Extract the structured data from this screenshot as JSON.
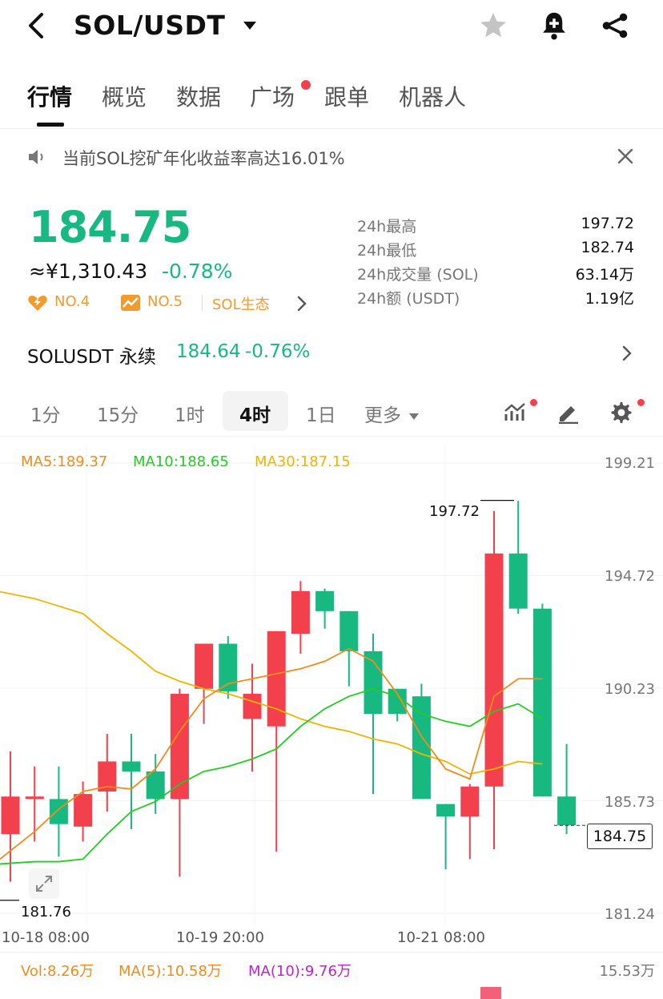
{
  "header": {
    "pair": "SOL/USDT"
  },
  "tabs": [
    {
      "label": "行情",
      "active": true
    },
    {
      "label": "概览"
    },
    {
      "label": "数据"
    },
    {
      "label": "广场",
      "dot": true
    },
    {
      "label": "跟单"
    },
    {
      "label": "机器人"
    }
  ],
  "notice": {
    "text": "当前SOL挖矿年化收益率高达16.01%"
  },
  "price": {
    "last": "184.75",
    "cny": "≈¥1,310.43",
    "change_pct": "-0.78%",
    "color_down": "#17b981",
    "color_up": "#f2404c"
  },
  "ranks": [
    {
      "label": "NO.4",
      "icon": "hot-icon"
    },
    {
      "label": "NO.5",
      "icon": "trend-icon"
    },
    {
      "label": "SOL生态",
      "icon": ""
    }
  ],
  "stats": [
    {
      "label": "24h最高",
      "value": "197.72"
    },
    {
      "label": "24h最低",
      "value": "182.74"
    },
    {
      "label": "24h成交量 (SOL)",
      "value": "63.14万"
    },
    {
      "label": "24h额 (USDT)",
      "value": "1.19亿"
    }
  ],
  "perpetual": {
    "name": "SOLUSDT 永续",
    "price": "184.64",
    "change_pct": "-0.76%"
  },
  "intervals": [
    {
      "label": "1分"
    },
    {
      "label": "15分"
    },
    {
      "label": "1时"
    },
    {
      "label": "4时",
      "active": true
    },
    {
      "label": "1日"
    },
    {
      "label": "更多"
    }
  ],
  "chart": {
    "ma_legend": [
      {
        "label": "MA5:189.37",
        "color": "#f08c1a"
      },
      {
        "label": "MA10:188.65",
        "color": "#22cc22"
      },
      {
        "label": "MA30:187.15",
        "color": "#f0b400"
      }
    ],
    "price_axis": [
      "199.21",
      "194.72",
      "190.23",
      "185.73",
      "181.24"
    ],
    "time_axis": [
      "10-18 08:00",
      "10-19 20:00",
      "10-21 08:00"
    ],
    "high_label": "197.72",
    "low_label": "181.76",
    "current_tag": "184.75"
  },
  "chart_data": {
    "type": "candlestick",
    "ylim": [
      181.24,
      199.21
    ],
    "candles": [
      {
        "o": 184.4,
        "h": 187.7,
        "l": 182.5,
        "c": 185.9
      },
      {
        "o": 185.8,
        "h": 187.1,
        "l": 184.1,
        "c": 185.9
      },
      {
        "o": 185.8,
        "h": 187.1,
        "l": 183.5,
        "c": 184.8
      },
      {
        "o": 184.7,
        "h": 186.5,
        "l": 184.1,
        "c": 186.0
      },
      {
        "o": 186.1,
        "h": 188.4,
        "l": 185.3,
        "c": 187.3
      },
      {
        "o": 187.3,
        "h": 188.4,
        "l": 184.6,
        "c": 186.9
      },
      {
        "o": 186.9,
        "h": 187.6,
        "l": 185.2,
        "c": 185.8
      },
      {
        "o": 185.8,
        "h": 190.2,
        "l": 182.7,
        "c": 190.0
      },
      {
        "o": 190.2,
        "h": 191.8,
        "l": 188.8,
        "c": 192.0
      },
      {
        "o": 192.0,
        "h": 192.3,
        "l": 189.8,
        "c": 190.1
      },
      {
        "o": 189.0,
        "h": 191.2,
        "l": 186.9,
        "c": 190.0
      },
      {
        "o": 188.7,
        "h": 192.5,
        "l": 183.7,
        "c": 192.5
      },
      {
        "o": 192.4,
        "h": 194.5,
        "l": 191.6,
        "c": 194.1
      },
      {
        "o": 194.1,
        "h": 194.2,
        "l": 192.6,
        "c": 193.3
      },
      {
        "o": 193.3,
        "h": 193.3,
        "l": 190.3,
        "c": 191.7
      },
      {
        "o": 191.7,
        "h": 192.4,
        "l": 186.0,
        "c": 189.2
      },
      {
        "o": 190.2,
        "h": 190.2,
        "l": 188.9,
        "c": 189.2
      },
      {
        "o": 189.9,
        "h": 190.4,
        "l": 185.8,
        "c": 185.8
      },
      {
        "o": 185.6,
        "h": 185.6,
        "l": 183.0,
        "c": 185.1
      },
      {
        "o": 185.1,
        "h": 186.4,
        "l": 183.4,
        "c": 186.3
      },
      {
        "o": 186.3,
        "h": 197.3,
        "l": 183.8,
        "c": 195.6
      },
      {
        "o": 195.6,
        "h": 197.7,
        "l": 193.2,
        "c": 193.4
      },
      {
        "o": 193.4,
        "h": 193.6,
        "l": 185.9,
        "c": 185.9
      },
      {
        "o": 185.9,
        "h": 188.0,
        "l": 184.4,
        "c": 184.75
      }
    ],
    "ma5": [
      183.3,
      184.5,
      185.4,
      186.1,
      186.3,
      186.2,
      187.0,
      188.5,
      189.8,
      190.4,
      190.6,
      190.8,
      191.0,
      191.3,
      191.8,
      191.3,
      190.0,
      188.3,
      187.0,
      186.6,
      189.9,
      190.6,
      190.6
    ],
    "ma10": [
      183.2,
      183.3,
      183.3,
      183.4,
      184.4,
      185.3,
      185.7,
      186.4,
      186.9,
      187.1,
      187.4,
      187.8,
      188.7,
      189.4,
      189.9,
      190.2,
      189.9,
      189.2,
      188.9,
      188.7,
      189.3,
      189.6,
      189.0
    ],
    "ma30": [
      194.1,
      193.8,
      193.5,
      193.2,
      192.4,
      191.7,
      190.9,
      190.5,
      190.2,
      190.0,
      189.7,
      189.4,
      189.0,
      188.7,
      188.5,
      188.2,
      188.0,
      187.6,
      187.3,
      186.8,
      187.0,
      187.3,
      187.2
    ]
  },
  "volume": {
    "vol": "Vol:8.26万",
    "ma5": "MA(5):10.58万",
    "ma10": "MA(10):9.76万",
    "scale": "15.53万",
    "color_vol": "#f08c1a",
    "color_ma5": "#f08c1a",
    "color_ma10": "#c020d0"
  }
}
